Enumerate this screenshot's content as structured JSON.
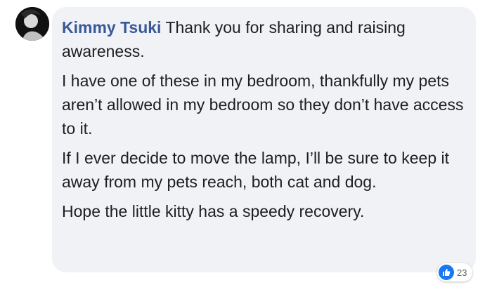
{
  "comment": {
    "author": "Kimmy Tsuki",
    "paragraphs": [
      "Thank you for sharing and raising awareness.",
      "I have one of these in my bedroom, thankfully my pets aren’t allowed in my bedroom so they don’t have access to it.",
      "If I ever decide to move the lamp, I’ll be sure to keep it away from my pets reach, both cat and dog.",
      "Hope the little kitty has a speedy recovery."
    ]
  },
  "reactions": {
    "icon": "like-icon",
    "count": "23",
    "color": "#1877f2"
  },
  "colors": {
    "author": "#385898",
    "bubble": "#f0f2f5",
    "text": "#1c1e21"
  }
}
